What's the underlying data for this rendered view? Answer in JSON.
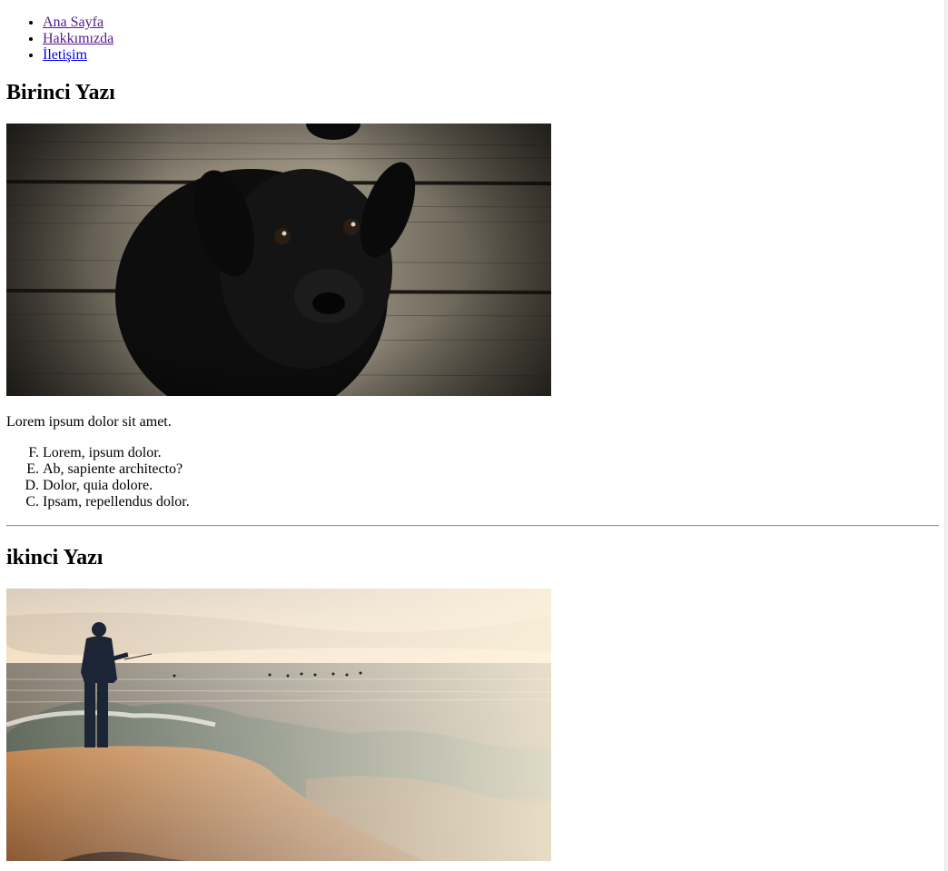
{
  "nav": {
    "items": [
      {
        "label": "Ana Sayfa",
        "visited": true
      },
      {
        "label": "Hakkımızda",
        "visited": true
      },
      {
        "label": "İletişim",
        "visited": false
      }
    ]
  },
  "post1": {
    "title": "Birinci Yazı",
    "image_subject": "black puppy on wooden planks",
    "paragraph": "Lorem ipsum dolor sit amet.",
    "list_markers": [
      "F.",
      "E.",
      "D.",
      "C."
    ],
    "list": [
      "Lorem, ipsum dolor.",
      "Ab, sapiente architecto?",
      "Dolor, quia dolore.",
      "Ipsam, repellendus dolor."
    ]
  },
  "post2": {
    "title": "ikinci Yazı",
    "image_subject": "fisherman on rocky shore at sunset"
  },
  "colors": {
    "link": "#0000ee",
    "visited_link": "#551a8b",
    "separator": "#9a9a9a"
  }
}
